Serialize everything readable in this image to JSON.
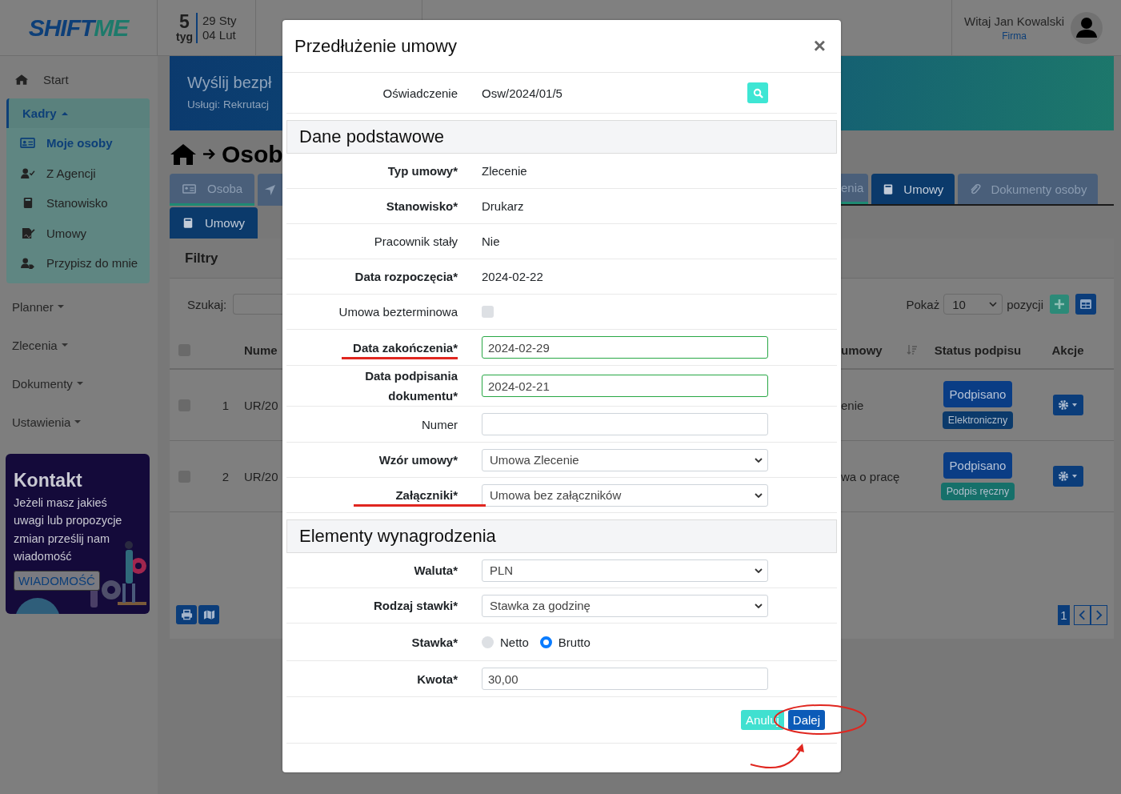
{
  "header": {
    "logo": [
      "SHIFT",
      "ME"
    ],
    "week": {
      "number": "5",
      "unit": "tyg",
      "from": "29 Sty",
      "to": "04 Lut"
    },
    "user": {
      "greeting": "Witaj Jan Kowalski",
      "company": "Firma"
    }
  },
  "sidebar": {
    "start": "Start",
    "group": {
      "label": "Kadry",
      "expanded": true,
      "items": [
        {
          "label": "Moje osoby",
          "selected": true
        },
        {
          "label": "Z Agencji",
          "selected": false
        },
        {
          "label": "Stanowisko",
          "selected": false
        },
        {
          "label": "Umowy",
          "selected": false
        },
        {
          "label": "Przypisz do mnie",
          "selected": false
        }
      ]
    },
    "menus": [
      {
        "label": "Planner",
        "expanded": false
      },
      {
        "label": "Zlecenia",
        "expanded": false
      },
      {
        "label": "Dokumenty",
        "expanded": false
      },
      {
        "label": "Ustawienia",
        "expanded": false
      }
    ],
    "contact": {
      "title": "Kontakt",
      "text": "Jeżeli masz jakieś uwagi lub propozycje zmian prześlij nam wiadomość",
      "button": "WIADOMOŚĆ"
    }
  },
  "main": {
    "banner": {
      "title": "Wyślij bezpł",
      "subtitle": "Usługi: Rekrutacj"
    },
    "breadcrumb": {
      "title": "Osob"
    },
    "tabs_left": [
      {
        "label": "Osoba",
        "selected": false
      },
      {
        "kind": "icon",
        "selected": false
      }
    ],
    "tabs_right": [
      {
        "label": "enia",
        "selected": false
      },
      {
        "label": "Umowy",
        "selected": true
      },
      {
        "label": "Dokumenty osoby",
        "selected": false
      }
    ],
    "subtabs": [
      {
        "label": "Umowy",
        "selected": true
      }
    ],
    "filters": {
      "title": "Filtry"
    },
    "search": {
      "label": "Szukaj:"
    },
    "page_size": {
      "before": "Pokaż",
      "value": "10",
      "after": "pozycji"
    },
    "table": {
      "select_all": {
        "checked": false
      },
      "columns_left": [
        "Nume"
      ],
      "columns_right": [
        "umowy",
        "Status podpisu",
        "Akcje"
      ],
      "rows": [
        {
          "checked": false,
          "index": "1",
          "number": "UR/20",
          "type": "enie",
          "status": "Podpisano",
          "signature": "Elektroniczny",
          "color": "#0b3a6b"
        },
        {
          "checked": false,
          "index": "2",
          "number": "UR/20",
          "type": "wa o pracę",
          "status": "Podpisano",
          "signature": "Podpis ręczny",
          "color": "#16706a"
        }
      ]
    },
    "pagination": [
      {
        "label": "1",
        "selected": true
      }
    ]
  },
  "modal": {
    "title": "Przedłużenie umowy",
    "close": "×",
    "statement": {
      "label": "Oświadczenie",
      "value": "Osw/2024/01/5"
    },
    "sections": [
      {
        "title": "Dane podstawowe",
        "fields": [
          {
            "label": "Typ umowy*",
            "required": true,
            "kind": "text",
            "value": "Zlecenie"
          },
          {
            "label": "Stanowisko*",
            "required": true,
            "kind": "text",
            "value": "Drukarz"
          },
          {
            "label": "Pracownik stały",
            "required": false,
            "kind": "text",
            "value": "Nie"
          },
          {
            "label": "Data rozpoczęcia*",
            "required": true,
            "kind": "text",
            "value": "2024-02-22"
          },
          {
            "label": "Umowa bezterminowa",
            "required": false,
            "kind": "checkbox",
            "checked": false
          },
          {
            "label": "Data zakończenia*",
            "required": true,
            "kind": "input",
            "value": "2024-02-29",
            "valid": true,
            "annotated": true
          },
          {
            "label": "Data podpisania dokumentu*",
            "required": true,
            "kind": "input",
            "value": "2024-02-21",
            "valid": true
          },
          {
            "label": "Numer",
            "required": false,
            "kind": "input"
          },
          {
            "label": "Wzór umowy*",
            "required": true,
            "kind": "select",
            "value": "Umowa Zlecenie"
          },
          {
            "label": "Załączniki*",
            "required": true,
            "kind": "select",
            "value": "Umowa bez załączników",
            "annotated": true
          }
        ]
      },
      {
        "title": "Elementy wynagrodzenia",
        "fields": [
          {
            "label": "Waluta*",
            "required": true,
            "kind": "select",
            "value": "PLN"
          },
          {
            "label": "Rodzaj stawki*",
            "required": true,
            "kind": "select",
            "value": "Stawka za godzinę"
          },
          {
            "label": "Stawka*",
            "required": true,
            "kind": "radio",
            "options": [
              {
                "label": "Netto",
                "selected": false
              },
              {
                "label": "Brutto",
                "selected": true
              }
            ]
          },
          {
            "label": "Kwota*",
            "required": true,
            "kind": "input",
            "value": "30,00"
          }
        ]
      }
    ],
    "buttons": [
      {
        "label": "Anuluj",
        "kind": "secondary"
      },
      {
        "label": "Dalej",
        "kind": "primary",
        "annotated": true
      }
    ]
  }
}
